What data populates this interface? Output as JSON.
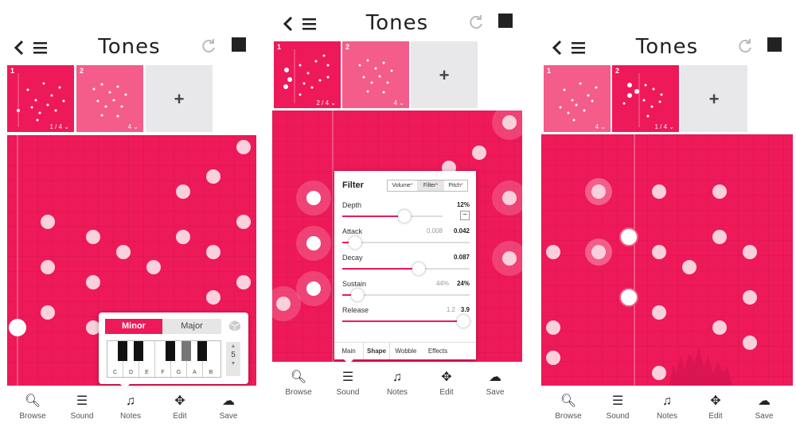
{
  "app": {
    "title": "Tones"
  },
  "colors": {
    "accent": "#ee1958",
    "accent_light": "#f45c8a",
    "tile_add": "#e8e8ea"
  },
  "icons": {
    "back": "chevron-left-icon",
    "menu": "hamburger-menu-icon",
    "refresh": "refresh-icon",
    "stop": "stop-square-icon",
    "add": "plus-icon"
  },
  "nav": [
    {
      "label": "Browse",
      "icon": "search-icon"
    },
    {
      "label": "Sound",
      "icon": "sliders-icon"
    },
    {
      "label": "Notes",
      "icon": "music-note-icon"
    },
    {
      "label": "Edit",
      "icon": "move-arrows-icon"
    },
    {
      "label": "Save",
      "icon": "cloud-upload-icon"
    }
  ],
  "screens": [
    {
      "patterns": [
        {
          "number": "1",
          "count": "1 / 4",
          "selected": true
        },
        {
          "number": "2",
          "count": "4",
          "selected": false
        }
      ],
      "scale_popup": {
        "mode_minor": "Minor",
        "mode_major": "Major",
        "keys": [
          "C",
          "D",
          "E",
          "F",
          "G",
          "A",
          "B"
        ],
        "octave": "5"
      }
    },
    {
      "patterns": [
        {
          "number": "1",
          "count": "2 / 4",
          "selected": true
        },
        {
          "number": "2",
          "count": "4",
          "selected": false
        }
      ],
      "filter": {
        "title": "Filter",
        "tabs": [
          "Volume",
          "Filter",
          "Pitch"
        ],
        "params": [
          {
            "name": "Depth",
            "value": "12%",
            "old_value": "",
            "level": 0.62
          },
          {
            "name": "Attack",
            "value": "0.042",
            "old_value": "0.008",
            "level": 0.1
          },
          {
            "name": "Decay",
            "value": "0.087",
            "old_value": "",
            "level": 0.6
          },
          {
            "name": "Sustain",
            "value": "24%",
            "old_value": "44%",
            "level": 0.12
          },
          {
            "name": "Release",
            "value": "3.9",
            "old_value": "1.2",
            "level": 0.95
          }
        ],
        "subtabs": [
          "Main",
          "Shape",
          "Wobble",
          "Effects"
        ]
      }
    },
    {
      "patterns": [
        {
          "number": "1",
          "count": "4",
          "selected": false
        },
        {
          "number": "2",
          "count": "1 / 4",
          "selected": true
        }
      ]
    }
  ]
}
